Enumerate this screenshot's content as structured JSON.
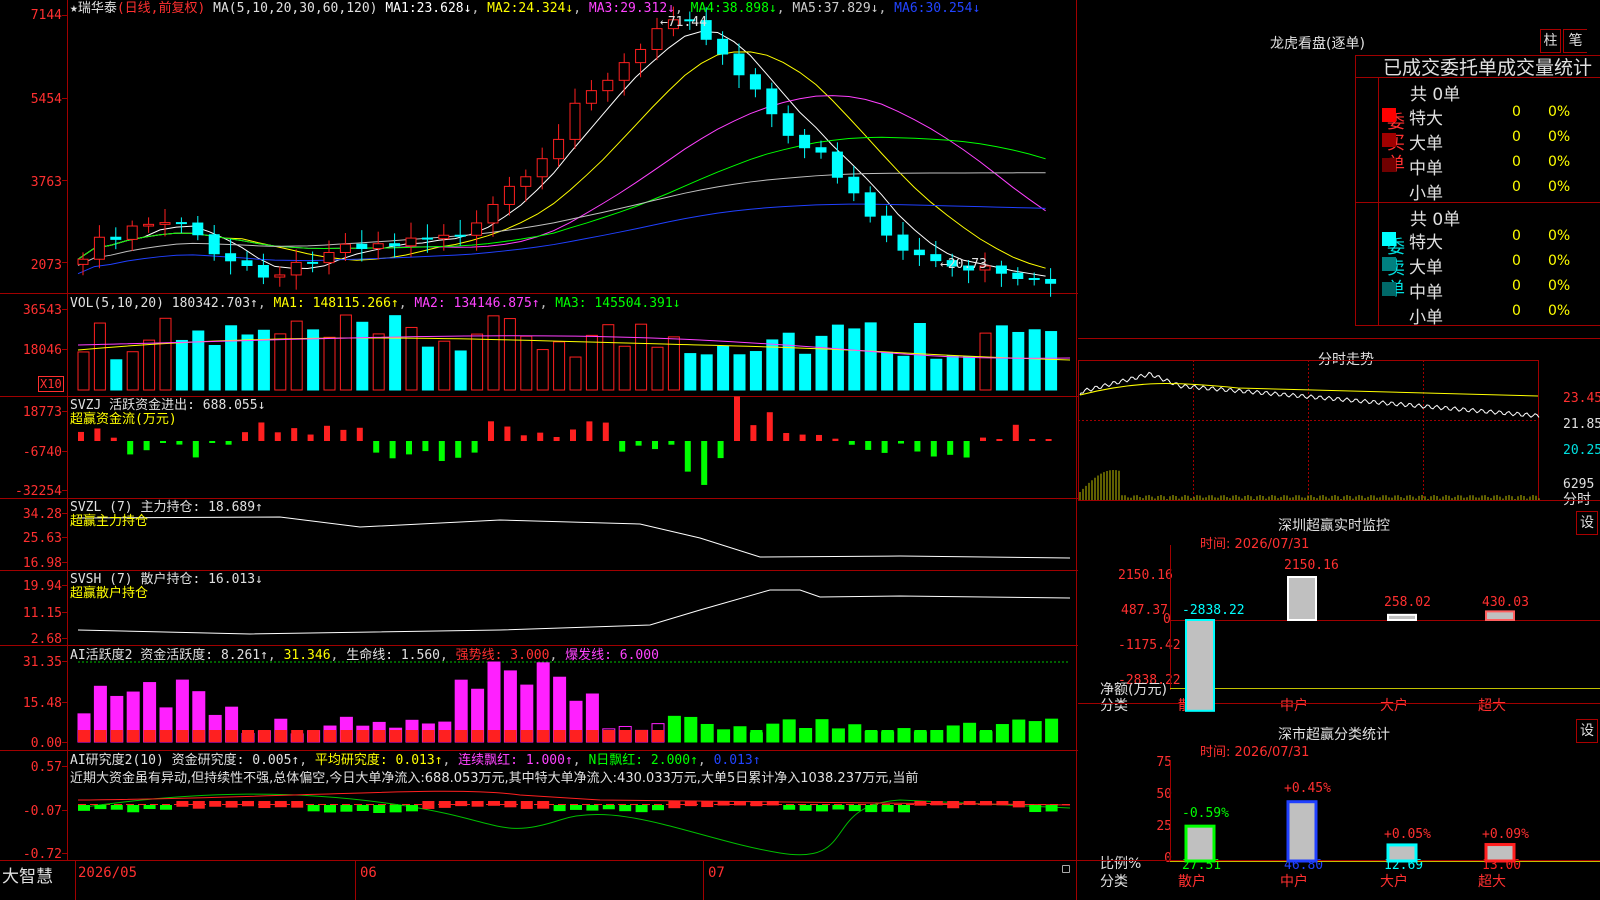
{
  "header": {
    "stock_name": "★瑞华泰",
    "period_tag": "(日线,前复权)",
    "ma_params": "MA(5,10,20,30,60,120)",
    "ma_values": [
      {
        "label": "MA1:",
        "value": "23.628↓",
        "color": "#ffffff"
      },
      {
        "label": "MA2:",
        "value": "24.324↓",
        "color": "#ffff00"
      },
      {
        "label": "MA3:",
        "value": "29.312↓",
        "color": "#ff40ff"
      },
      {
        "label": "MA4:",
        "value": "38.898↓",
        "color": "#00ff00"
      },
      {
        "label": "MA5:",
        "value": "37.829↓",
        "color": "#c0c0c0"
      },
      {
        "label": "MA6:",
        "value": "30.254↓",
        "color": "#2040ff"
      }
    ],
    "high_marker": "71.44",
    "low_marker": "←20.73"
  },
  "axes": {
    "price": [
      "7144",
      "5454",
      "3763",
      "2073"
    ],
    "vol": [
      "36543",
      "18046",
      "X10"
    ],
    "svzj": [
      "18773",
      "-6740",
      "-32254"
    ],
    "svzl": [
      "34.28",
      "25.63",
      "16.98"
    ],
    "svsh": [
      "19.94",
      "11.15",
      "2.68"
    ],
    "ai2": [
      "31.35",
      "15.48",
      "0.00"
    ],
    "ai_research": [
      "0.57",
      "-0.07",
      "-0.72"
    ]
  },
  "indicators": {
    "vol": {
      "title": "VOL(5,10,20)",
      "value": "180342.703↑",
      "ma1": "MA1: 148115.266↑",
      "ma2": "MA2: 134146.875↑",
      "ma3": "MA3: 145504.391↓"
    },
    "svzj": {
      "title": "SVZJ  活跃资金进出: 688.055↓",
      "sub": "超赢资金流(万元)"
    },
    "svzl": {
      "title": "SVZL (7) 主力持仓: 18.689↑",
      "sub": "超赢主力持仓"
    },
    "svsh": {
      "title": "SVSH (7) 散户持仓: 16.013↓",
      "sub": "超赢散户持仓"
    },
    "ai2": {
      "title": "AI活跃度2 资金活跃度: 8.261↑",
      "v2": "31.346",
      "v3": "生命线: 1.560",
      "v4": "强势线: 3.000",
      "v5": "爆发线: 6.000"
    },
    "ai_research": {
      "title": "AI研究度2(10) 资金研究度: 0.005↑",
      "v2": "平均研究度: 0.013↑",
      "v3": "连续飘红: 1.000↑",
      "v4": "N日飘红: 2.000↑",
      "v5": "0.013↑",
      "comment": "近期大资金虽有异动,但持续性不强,总体偏空,今日大单净流入:688.053万元,其中特大单净流入:430.033万元,大单5日累计净入1038.237万元,当前"
    }
  },
  "timeline": {
    "logo": "大智慧",
    "dates": [
      "2026/05",
      "06",
      "07"
    ]
  },
  "dragon": {
    "title": "龙虎看盘(逐单)",
    "btn_bar": "柱",
    "btn_pen": "笔",
    "subtitle": "已成交委托单成交量统计",
    "buy": {
      "side": "委买单",
      "total": "共 0单",
      "rows": [
        {
          "name": "特大",
          "count": "0",
          "pct": "0%",
          "color": "#ff0000"
        },
        {
          "name": "大单",
          "count": "0",
          "pct": "0%",
          "color": "#a00000"
        },
        {
          "name": "中单",
          "count": "0",
          "pct": "0%",
          "color": "#700000"
        },
        {
          "name": "小单",
          "count": "0",
          "pct": "0%",
          "color": "#000000"
        }
      ]
    },
    "sell": {
      "side": "委卖单",
      "total": "共 0单",
      "rows": [
        {
          "name": "特大",
          "count": "0",
          "pct": "0%",
          "color": "#00ffff"
        },
        {
          "name": "大单",
          "count": "0",
          "pct": "0%",
          "color": "#008080"
        },
        {
          "name": "中单",
          "count": "0",
          "pct": "0%",
          "color": "#006868"
        },
        {
          "name": "小单",
          "count": "0",
          "pct": "0%",
          "color": "#000000"
        }
      ]
    }
  },
  "intraday": {
    "title": "分时走势",
    "prices": [
      "23.45",
      "21.85",
      "20.25"
    ],
    "volume": "6295",
    "vol_label": "分时"
  },
  "sz_monitor": {
    "title": "深圳超赢实时监控",
    "btn": "设",
    "time": "时间: 2026/07/31",
    "axis": [
      "2150.16",
      "487.37",
      "0",
      "-1175.42",
      "-2838.22"
    ],
    "y_label": "净额(万元)",
    "x_label": "分类",
    "cats": [
      "散户",
      "中户",
      "大户",
      "超大"
    ],
    "values": [
      "-2838.22",
      "2150.16",
      "258.02",
      "430.03"
    ]
  },
  "sz_class": {
    "title": "深市超赢分类统计",
    "btn": "设",
    "time": "时间: 2026/07/31",
    "axis": [
      "75",
      "50",
      "25",
      "0"
    ],
    "y_label": "比例%",
    "x_label": "分类",
    "cats": [
      "散户",
      "中户",
      "大户",
      "超大"
    ],
    "changes": [
      "-0.59%",
      "+0.45%",
      "+0.05%",
      "+0.09%"
    ],
    "values": [
      "27.51",
      "46.80",
      "12.69",
      "13.00"
    ]
  }
}
